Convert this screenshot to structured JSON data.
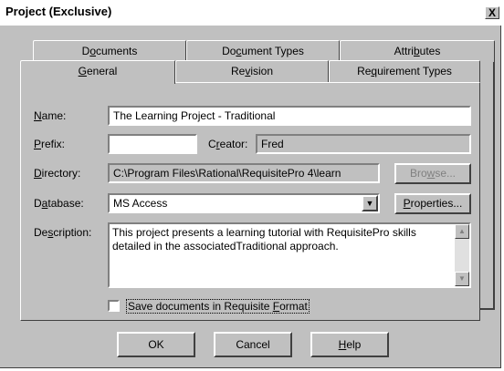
{
  "window": {
    "title": "Project (Exclusive)",
    "close_label": "X"
  },
  "tabs_back": [
    {
      "pre": "D",
      "accel": "o",
      "post": "cuments"
    },
    {
      "pre": "Do",
      "accel": "c",
      "post": "ument Types"
    },
    {
      "pre": "Attri",
      "accel": "b",
      "post": "utes"
    }
  ],
  "tabs_front": [
    {
      "pre": "",
      "accel": "G",
      "post": "eneral"
    },
    {
      "pre": "Re",
      "accel": "v",
      "post": "ision"
    },
    {
      "pre": "Re",
      "accel": "q",
      "post": "uirement Types"
    }
  ],
  "form": {
    "name_label": {
      "pre": "",
      "accel": "N",
      "post": "ame:"
    },
    "name_value": "The Learning Project - Traditional",
    "prefix_label": {
      "pre": "",
      "accel": "P",
      "post": "refix:"
    },
    "prefix_value": "",
    "creator_label": {
      "pre": "C",
      "accel": "r",
      "post": "eator:"
    },
    "creator_value": "Fred",
    "directory_label": {
      "pre": "",
      "accel": "D",
      "post": "irectory:"
    },
    "directory_value": "C:\\Program Files\\Rational\\RequisitePro 4\\learn",
    "browse_button": {
      "pre": "Bro",
      "accel": "w",
      "post": "se..."
    },
    "database_label": {
      "pre": "D",
      "accel": "a",
      "post": "tabase:"
    },
    "database_value": "MS Access",
    "properties_button": {
      "pre": "",
      "accel": "P",
      "post": "roperties..."
    },
    "description_label": {
      "pre": "De",
      "accel": "s",
      "post": "cription:"
    },
    "description_value": "This project presents a learning tutorial with  RequisitePro skills detailed in the associatedTraditional approach.",
    "save_checkbox": {
      "pre": "Save documents in Requisite ",
      "accel": "F",
      "post": "ormat"
    }
  },
  "buttons": {
    "ok": "OK",
    "cancel": "Cancel",
    "help": {
      "pre": "",
      "accel": "H",
      "post": "elp"
    }
  }
}
